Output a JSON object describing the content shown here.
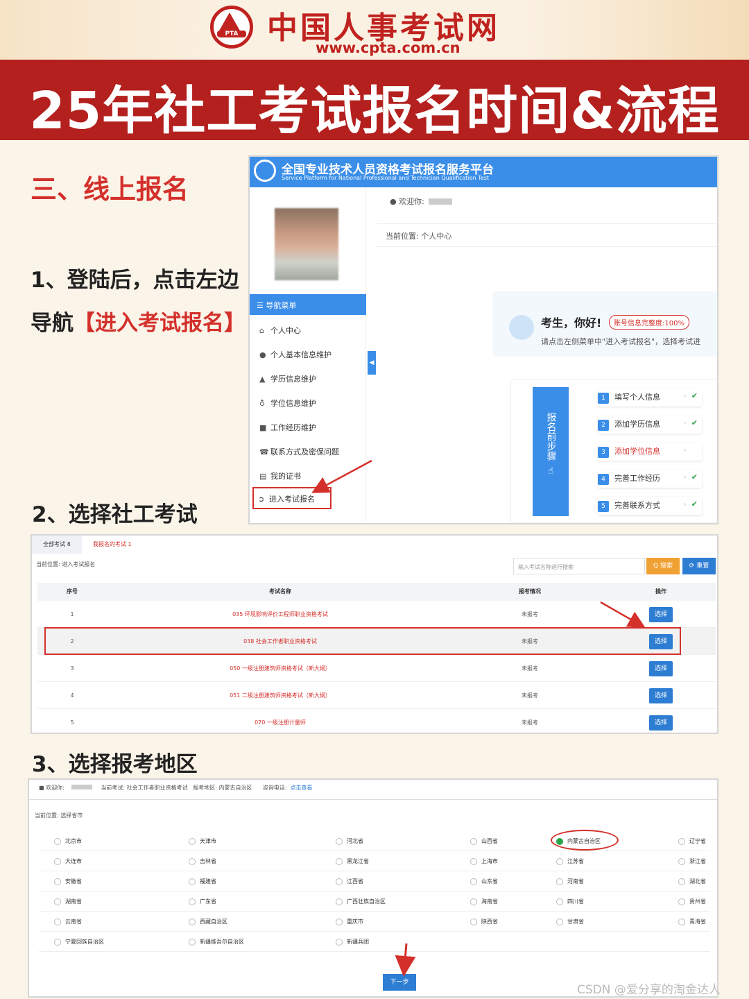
{
  "header": {
    "site_name": "中国人事考试网",
    "site_url": "www.cpta.com.cn",
    "logo_text": "PTA",
    "title": "25年社工考试报名时间&流程"
  },
  "instructions": {
    "section": "三、线上报名",
    "step1_line1": "1、登陆后，点击左边",
    "step1_line2_prefix": "导航",
    "step1_line2_highlight": "【进入考试报名】",
    "step2": "2、选择社工考试",
    "step3": "3、选择报考地区"
  },
  "portal": {
    "title": "全国专业技术人员资格考试报名服务平台",
    "subtitle": "Service Platform for National Professional and Technician Qualification Test",
    "welcome": "欢迎你:",
    "breadcrumb": "当前位置: 个人中心",
    "nav_header": "☰ 导航菜单",
    "nav_items": [
      "个人中心",
      "个人基本信息维护",
      "学历信息维护",
      "学位信息维护",
      "工作经历维护",
      "联系方式及密保问题",
      "我的证书",
      "进入考试报名"
    ],
    "greeting": "考生，你好!",
    "completeness": "账号信息完整度:100%",
    "tip": "请点击左侧菜单中\"进入考试报名\"，选择考试进",
    "steps_title": "报名前步骤",
    "steps": [
      {
        "num": "1",
        "label": "填写个人信息",
        "done": true
      },
      {
        "num": "2",
        "label": "添加学历信息",
        "done": true
      },
      {
        "num": "3",
        "label": "添加学位信息",
        "done": false
      },
      {
        "num": "4",
        "label": "完善工作经历",
        "done": true
      },
      {
        "num": "5",
        "label": "完善联系方式",
        "done": true
      }
    ]
  },
  "exam_list": {
    "tab_all": "全部考试 8",
    "tab_mine": "我报名的考试 1",
    "breadcrumb": "当前位置: 进入考试报名",
    "search_placeholder": "输入考试名称进行搜索",
    "search_btn": "Q 搜索",
    "reset_btn": "⟳ 重置",
    "columns": [
      "序号",
      "考试名称",
      "报考情况",
      "操作"
    ],
    "rows": [
      {
        "no": "1",
        "name": "035 环境影响评价工程师职业资格考试",
        "status": "未报考",
        "action": "选择"
      },
      {
        "no": "2",
        "name": "038 社会工作者职业资格考试",
        "status": "未报考",
        "action": "选择"
      },
      {
        "no": "3",
        "name": "050 一级注册建筑师资格考试（新大纲）",
        "status": "未报考",
        "action": "选择"
      },
      {
        "no": "4",
        "name": "051 二级注册建筑师资格考试（新大纲）",
        "status": "未报考",
        "action": "选择"
      },
      {
        "no": "5",
        "name": "070 一级注册计量师",
        "status": "未报考",
        "action": "选择"
      }
    ]
  },
  "region": {
    "welcome": "欢迎你:",
    "current_exam": "当前考试: 社会工作者职业资格考试",
    "region": "报考地区: 内蒙古自治区",
    "phone_label": "咨询电话:",
    "phone_link": "点击查看",
    "breadcrumb": "当前位置: 选择省市",
    "provinces": [
      [
        "北京市",
        "天津市",
        "河北省",
        "山西省",
        "内蒙古自治区",
        "辽宁省"
      ],
      [
        "大连市",
        "吉林省",
        "黑龙江省",
        "上海市",
        "江苏省",
        "浙江省"
      ],
      [
        "安徽省",
        "福建省",
        "江西省",
        "山东省",
        "河南省",
        "湖北省"
      ],
      [
        "湖南省",
        "广东省",
        "广西壮族自治区",
        "海南省",
        "四川省",
        "贵州省"
      ],
      [
        "云南省",
        "西藏自治区",
        "重庆市",
        "陕西省",
        "甘肃省",
        "青海省"
      ],
      [
        "宁夏回族自治区",
        "新疆维吾尔自治区",
        "新疆兵团"
      ]
    ],
    "selected": "内蒙古自治区",
    "next_btn": "下一步"
  },
  "watermark": "CSDN @爱分享的淘金达人",
  "colors": {
    "brand_red": "#b3201e",
    "accent_red": "#d4302b",
    "portal_blue": "#3a8ee8",
    "button_blue": "#2d7dd2",
    "check_green": "#2aa34a"
  }
}
